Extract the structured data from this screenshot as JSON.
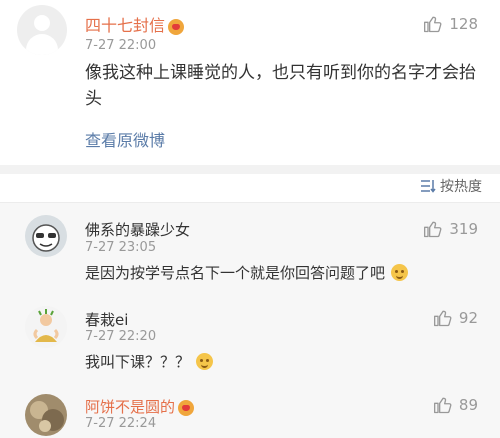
{
  "post": {
    "author": "四十七封信",
    "time": "7-27 22:00",
    "text": "像我这种上课睡觉的人，也只有听到你的名字才会抬头",
    "like_count": "128",
    "view_original": "查看原微博"
  },
  "sort": {
    "label": "按热度"
  },
  "comments": [
    {
      "author": "佛系的暴躁少女",
      "time": "7-27 23:05",
      "text": "是因为按学号点名下一个就是你回答问题了吧",
      "likes": "319",
      "emoji": "smile-emoji"
    },
    {
      "author": "春栽ei",
      "time": "7-27 22:20",
      "text": "我叫下课？？？",
      "likes": "92",
      "emoji": "smile-emoji"
    },
    {
      "author": "阿饼不是圆的",
      "time": "7-27 22:24",
      "likes": "89"
    }
  ],
  "colors": {
    "vip_name": "#e5704a",
    "link": "#5b7ca8",
    "muted": "#999999"
  },
  "icons": {
    "like": "thumbs-up-icon",
    "sort": "sort-list-icon",
    "badge": "vip-badge-icon"
  }
}
